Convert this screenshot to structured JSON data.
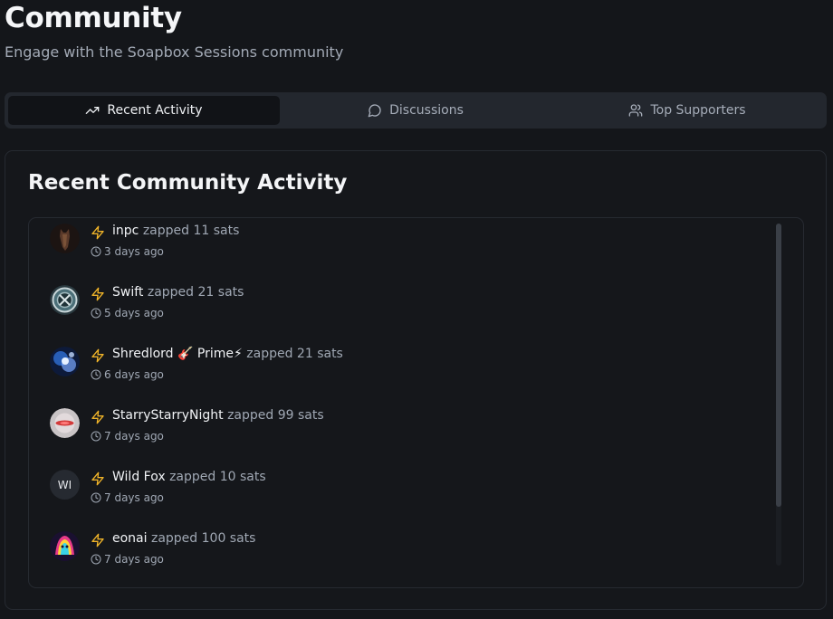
{
  "header": {
    "title": "Community",
    "subtitle": "Engage with the Soapbox Sessions community"
  },
  "tabs": [
    {
      "label": "Recent Activity",
      "icon": "trending-up-icon",
      "active": true
    },
    {
      "label": "Discussions",
      "icon": "message-circle-icon",
      "active": false
    },
    {
      "label": "Top Supporters",
      "icon": "users-icon",
      "active": false
    }
  ],
  "card": {
    "title": "Recent Community Activity"
  },
  "activity": [
    {
      "user": "inpc",
      "action": "zapped 11 sats",
      "time": "3 days ago",
      "avatar": "horse-photo"
    },
    {
      "user": "Swift",
      "action": "zapped 21 sats",
      "time": "5 days ago",
      "avatar": "compass-badge"
    },
    {
      "user": "Shredlord 🎸 Prime⚡",
      "action": "zapped 21 sats",
      "time": "6 days ago",
      "avatar": "nebula"
    },
    {
      "user": "StarryStarryNight",
      "action": "zapped 99 sats",
      "time": "7 days ago",
      "avatar": "red-swirl"
    },
    {
      "user": "Wild Fox",
      "action": "zapped 10 sats",
      "time": "7 days ago",
      "avatar_initials": "WI"
    },
    {
      "user": "eonai",
      "action": "zapped 100 sats",
      "time": "7 days ago",
      "avatar": "rainbow-figure"
    }
  ],
  "colors": {
    "background": "#14161a",
    "zap_accent": "#f0b429",
    "muted_text": "#a0a8b4"
  }
}
